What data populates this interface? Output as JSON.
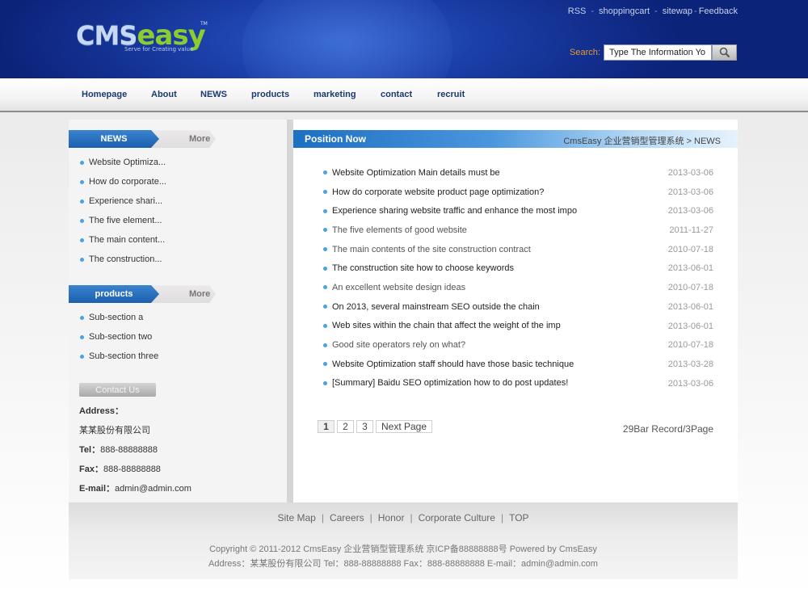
{
  "header": {
    "logo": {
      "part1": "CMS",
      "part2": "easy",
      "tm": "TM",
      "slogan": "Serve for Creating value"
    },
    "top_links": [
      "RSS",
      "shoppingcart",
      "sitewap",
      "Feedback"
    ],
    "search_label": "Search:",
    "search_value": "Type The Information Yo"
  },
  "nav": [
    "Homepage",
    "About",
    "NEWS",
    "products",
    "marketing",
    "contact",
    "recruit"
  ],
  "sidebar": {
    "news": {
      "title": "NEWS",
      "more": "More",
      "items": [
        "Website Optimiza...",
        "How do corporate...",
        "Experience shari...",
        "The five element...",
        "The main content...",
        "The construction..."
      ]
    },
    "products": {
      "title": "products",
      "more": "More",
      "items": [
        "Sub-section a",
        "Sub-section two",
        "Sub-section three"
      ]
    },
    "contact": {
      "button": "Contact Us",
      "address_label": "Address：",
      "address_value": "某某股份有限公司",
      "tel_label": "Tel：",
      "tel_value": "888-88888888",
      "fax_label": "Fax：",
      "fax_value": "888-88888888",
      "email_label": "E-mail：",
      "email_value": "admin@admin.com"
    }
  },
  "main": {
    "position_title": "Position Now",
    "breadcrumb": "CmsEasy 企业营销型管理系统 > NEWS",
    "news": [
      {
        "title": "Website Optimization Main details must be",
        "date": "2013-03-06",
        "dark": true
      },
      {
        "title": "How do corporate website product page optimization?",
        "date": "2013-03-06",
        "dark": true
      },
      {
        "title": "Experience sharing website traffic and enhance the most impo",
        "date": "2013-03-06",
        "dark": true
      },
      {
        "title": "The five elements of good website",
        "date": "2011-11-27",
        "dark": false
      },
      {
        "title": "The main contents of the site construction contract",
        "date": "2010-07-18",
        "dark": false
      },
      {
        "title": "The construction site how to choose keywords",
        "date": "2013-06-01",
        "dark": true
      },
      {
        "title": "An excellent website design ideas",
        "date": "2010-07-18",
        "dark": false
      },
      {
        "title": "On 2013, several mainstream SEO outside the chain",
        "date": "2013-06-01",
        "dark": true
      },
      {
        "title": "Web sites within the chain that affect the weight of the imp",
        "date": "2013-06-01",
        "dark": true
      },
      {
        "title": "Good site operators rely on what?",
        "date": "2010-07-18",
        "dark": false
      },
      {
        "title": "Website Optimization staff should have those basic technique",
        "date": "2013-03-28",
        "dark": true
      },
      {
        "title": "[Summary] Baidu SEO optimization how to do post updates!",
        "date": "2013-03-06",
        "dark": true
      }
    ],
    "pager": [
      "1",
      "2",
      "3",
      "Next Page"
    ],
    "record": "29Bar Record/3Page"
  },
  "footer": {
    "links": [
      "Site Map",
      "Careers",
      "Honor",
      "Corporate Culture",
      "TOP"
    ],
    "copyright": "Copyright © 2011-2012  CmsEasy 企业营销型管理系统  京ICP备88888888号  Powered by CmsEasy",
    "address": "Address：某某股份有限公司  Tel：888-88888888  Fax：888-88888888  E-mail：admin@admin.com"
  },
  "colors": {
    "brand_blue": "#1d6fc1",
    "nav_text": "#1a3a6c",
    "search_label": "#e29a2e",
    "bullet": "#4aa3df",
    "logo_green": "#8ccc2e"
  }
}
